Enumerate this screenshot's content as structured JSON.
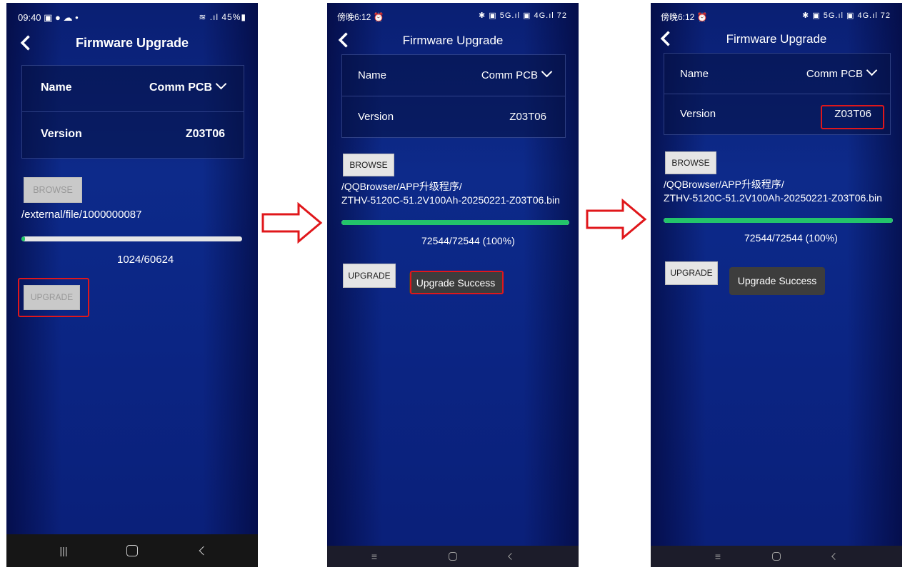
{
  "accent_red": "#e0171b",
  "progress_green": "#23c46a",
  "screens": [
    {
      "status_time": "09:40 ▣ ● ☁ •",
      "status_icons": "≋ .ıl 45%▮",
      "title": "Firmware Upgrade",
      "name_label": "Name",
      "name_value": "Comm PCB",
      "version_label": "Version",
      "version_value": "Z03T06",
      "browse_label": "BROWSE",
      "file_path_line1": "/external/file/1000000087",
      "progress_text": "1024/60624",
      "progress_fraction": 0.017,
      "upgrade_label": "UPGRADE",
      "nav_recent": "|||"
    },
    {
      "status_time": "傍晚6:12 ⏰",
      "status_icons": "✱ ▣ 5G.ıl ▣ 4G.ıl 72",
      "title": "Firmware Upgrade",
      "name_label": "Name",
      "name_value": "Comm PCB",
      "version_label": "Version",
      "version_value": "Z03T06",
      "browse_label": "BROWSE",
      "file_path_line1": "/QQBrowser/APP升级程序/",
      "file_path_line2": "ZTHV-5120C-51.2V100Ah-20250221-Z03T06.bin",
      "progress_text": "72544/72544 (100%)",
      "progress_fraction": 1.0,
      "upgrade_label": "UPGRADE",
      "toast": "Upgrade Success",
      "nav_recent": "≡"
    },
    {
      "status_time": "傍晚6:12 ⏰",
      "status_icons": "✱ ▣ 5G.ıl ▣ 4G.ıl 72",
      "title": "Firmware Upgrade",
      "name_label": "Name",
      "name_value": "Comm PCB",
      "version_label": "Version",
      "version_value": "Z03T06",
      "browse_label": "BROWSE",
      "file_path_line1": "/QQBrowser/APP升级程序/",
      "file_path_line2": "ZTHV-5120C-51.2V100Ah-20250221-Z03T06.bin",
      "progress_text": "72544/72544 (100%)",
      "progress_fraction": 1.0,
      "upgrade_label": "UPGRADE",
      "toast": "Upgrade Success",
      "nav_recent": "≡"
    }
  ]
}
